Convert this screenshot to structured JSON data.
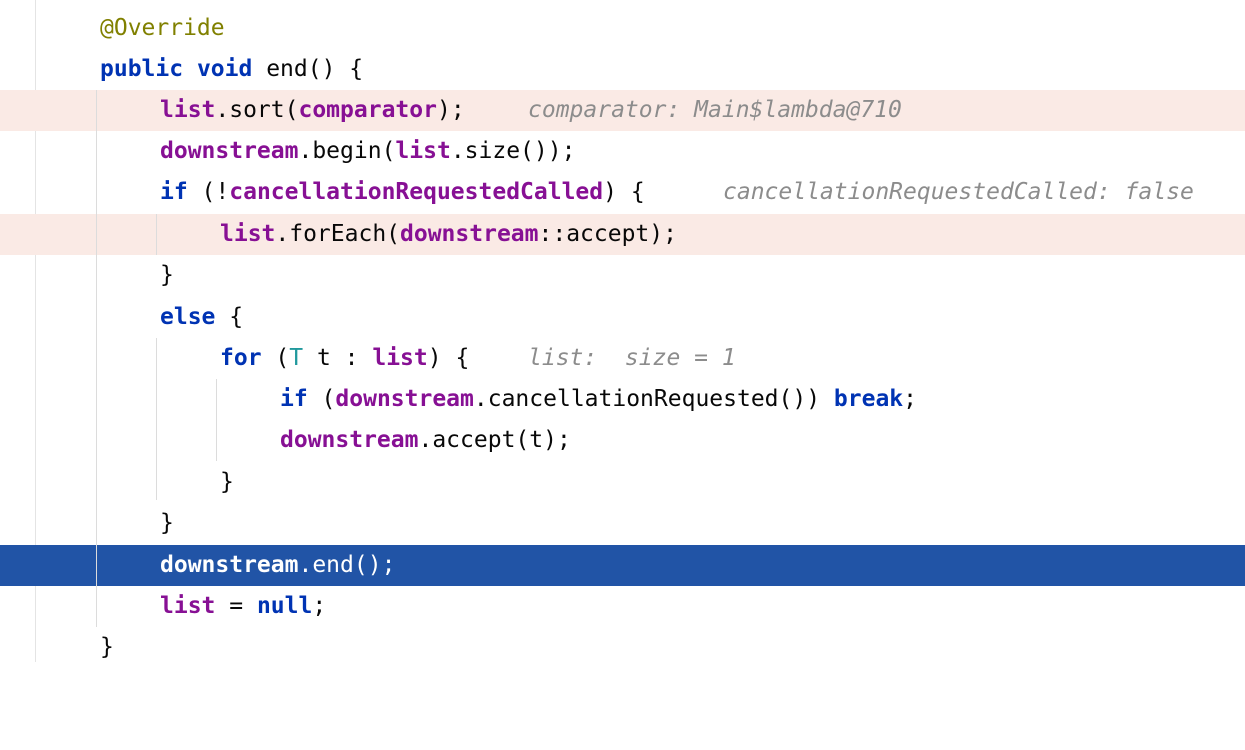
{
  "editor": {
    "lines": {
      "l1": {
        "annotation": "@Override"
      },
      "l2": {
        "kw1": "public",
        "kw2": "void",
        "rest": " end() {"
      },
      "l3": {
        "field1": "list",
        "t1": ".sort(",
        "field2": "comparator",
        "t2": ");",
        "inlay": "comparator: Main$lambda@710"
      },
      "l4": {
        "field1": "downstream",
        "t1": ".begin(",
        "field2": "list",
        "t2": ".size());"
      },
      "l5": {
        "kw": "if",
        "t1": " (!",
        "field": "cancellationRequestedCalled",
        "t2": ") {",
        "inlay": "cancellationRequestedCalled: false"
      },
      "l6": {
        "field1": "list",
        "t1": ".forEach(",
        "field2": "downstream",
        "t2": "::accept);"
      },
      "l7": {
        "t": "}"
      },
      "l8": {
        "kw": "else",
        "t": " {"
      },
      "l9": {
        "kw": "for",
        "t1": " (",
        "tparam": "T",
        "t2": " t : ",
        "field": "list",
        "t3": ") {",
        "inlay": "list:  size = 1"
      },
      "l10": {
        "kw1": "if",
        "t1": " (",
        "field": "downstream",
        "t2": ".cancellationRequested()) ",
        "kw2": "break",
        "t3": ";"
      },
      "l11": {
        "field": "downstream",
        "t": ".accept(t);"
      },
      "l12": {
        "t": "}"
      },
      "l13": {
        "t": "}"
      },
      "l14": {
        "field": "downstream",
        "t": ".end();"
      },
      "l15": {
        "field": "list",
        "t1": " = ",
        "kw": "null",
        "t2": ";"
      },
      "l16": {
        "t": "}"
      }
    }
  }
}
